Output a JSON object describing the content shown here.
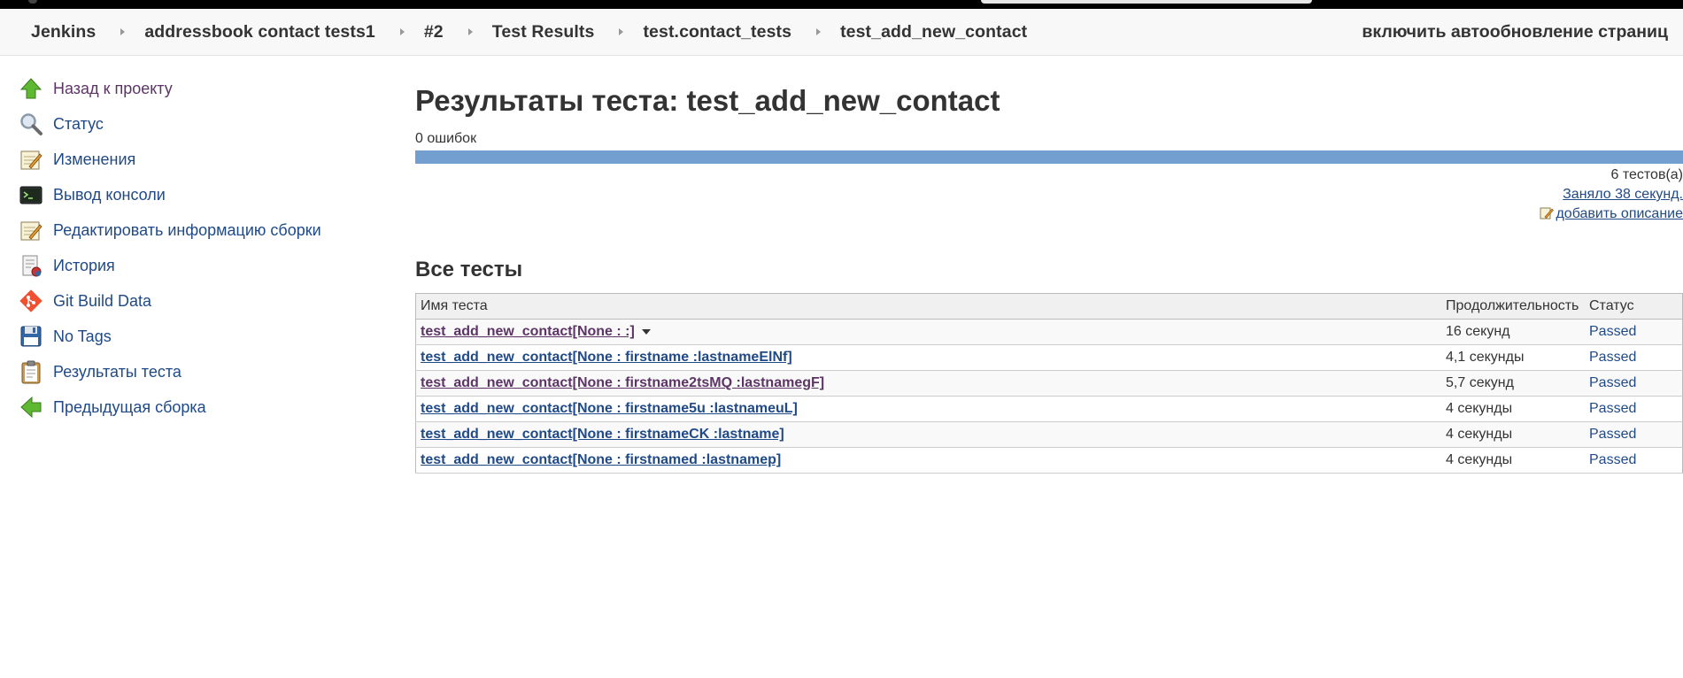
{
  "breadcrumbs": [
    {
      "label": "Jenkins"
    },
    {
      "label": "addressbook contact tests1"
    },
    {
      "label": "#2"
    },
    {
      "label": "Test Results"
    },
    {
      "label": "test.contact_tests"
    },
    {
      "label": "test_add_new_contact"
    }
  ],
  "header": {
    "autorefresh": "включить автообновление страниц"
  },
  "sidebar": {
    "items": [
      {
        "label": "Назад к проекту",
        "icon": "up-arrow-icon"
      },
      {
        "label": "Статус",
        "icon": "magnifier-icon"
      },
      {
        "label": "Изменения",
        "icon": "notepad-icon"
      },
      {
        "label": "Вывод консоли",
        "icon": "terminal-icon"
      },
      {
        "label": "Редактировать информацию сборки",
        "icon": "notepad-edit-icon"
      },
      {
        "label": "История",
        "icon": "history-icon"
      },
      {
        "label": "Git Build Data",
        "icon": "git-icon"
      },
      {
        "label": "No Tags",
        "icon": "floppy-icon"
      },
      {
        "label": "Результаты теста",
        "icon": "clipboard-icon"
      },
      {
        "label": "Предыдущая сборка",
        "icon": "left-arrow-icon"
      }
    ]
  },
  "main": {
    "title": "Результаты теста: test_add_new_contact",
    "failures": "0 ошибок",
    "pass_fraction": 1.0,
    "test_count": "6 тестов(а)",
    "duration": "Заняло 38 секунд.",
    "add_description": "добавить описание",
    "section_title": "Все тесты"
  },
  "table": {
    "headers": {
      "name": "Имя теста",
      "duration": "Продолжительность",
      "status": "Статус"
    },
    "rows": [
      {
        "name": "test_add_new_contact[None : :]",
        "duration": "16 секунд",
        "status": "Passed"
      },
      {
        "name": "test_add_new_contact[None : firstname :lastnameElNf]",
        "duration": "4,1 секунды",
        "status": "Passed"
      },
      {
        "name": "test_add_new_contact[None : firstname2tsMQ :lastnamegF]",
        "duration": "5,7 секунд",
        "status": "Passed"
      },
      {
        "name": "test_add_new_contact[None : firstname5u :lastnameuL]",
        "duration": "4 секунды",
        "status": "Passed"
      },
      {
        "name": "test_add_new_contact[None : firstnameCK :lastname]",
        "duration": "4 секунды",
        "status": "Passed"
      },
      {
        "name": "test_add_new_contact[None : firstnamed :lastnamep]",
        "duration": "4 секунды",
        "status": "Passed"
      }
    ]
  },
  "colors": {
    "link": "#204a87",
    "visited": "#5c3566",
    "bar": "#729fcf"
  }
}
